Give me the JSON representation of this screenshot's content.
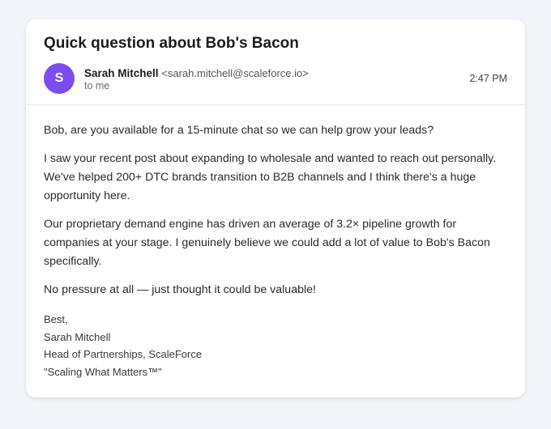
{
  "email": {
    "subject": "Quick question about Bob's Bacon",
    "sender": {
      "avatar_initial": "S",
      "avatar_color": "#7c4dee",
      "name": "Sarah Mitchell",
      "email": "<sarah.mitchell@scaleforce.io>",
      "recipient": "to me"
    },
    "time": "2:47 PM",
    "body": [
      "Bob, are you available for a 15-minute chat so we can help grow your leads?",
      "I saw your recent post about expanding to wholesale and wanted to reach out personally. We've helped 200+ DTC brands transition to B2B channels and I think there's a huge opportunity here.",
      "Our proprietary demand engine has driven an average of 3.2× pipeline growth for companies at your stage. I genuinely believe we could add a lot of value to Bob's Bacon specifically.",
      "No pressure at all — just thought it could be valuable!"
    ],
    "signature": {
      "closing": "Best,",
      "name": "Sarah Mitchell",
      "title": "Head of Partnerships, ScaleForce",
      "tagline": "\"Scaling What Matters™\""
    }
  }
}
